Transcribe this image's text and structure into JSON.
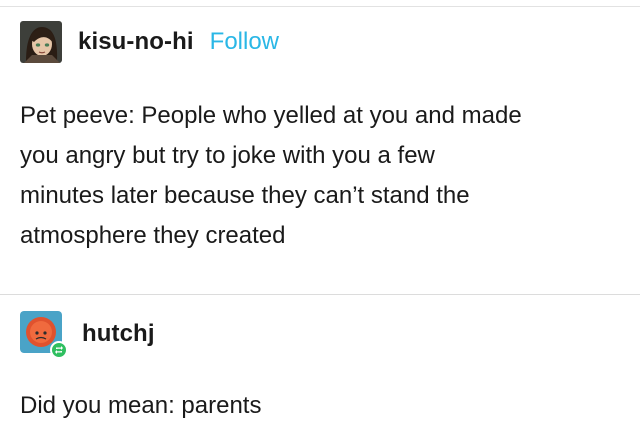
{
  "post": {
    "author": "kisu-no-hi",
    "follow_label": "Follow",
    "text": "Pet peeve: People who yelled at you and made\nyou angry but try to joke with you a few\nminutes later because they can’t stand the\natmosphere they created"
  },
  "reply": {
    "author": "hutchj",
    "text": "Did you mean: parents"
  },
  "colors": {
    "follow": "#2ab7e6",
    "reblog_badge": "#2fbf60",
    "reply_avatar_bg": "#4aa3c7",
    "reply_avatar_face": "#e0522e"
  },
  "icons": {
    "first_avatar": "anime-girl-avatar",
    "reply_avatar": "orange-face-avatar",
    "reblog_badge": "reblog-icon"
  }
}
